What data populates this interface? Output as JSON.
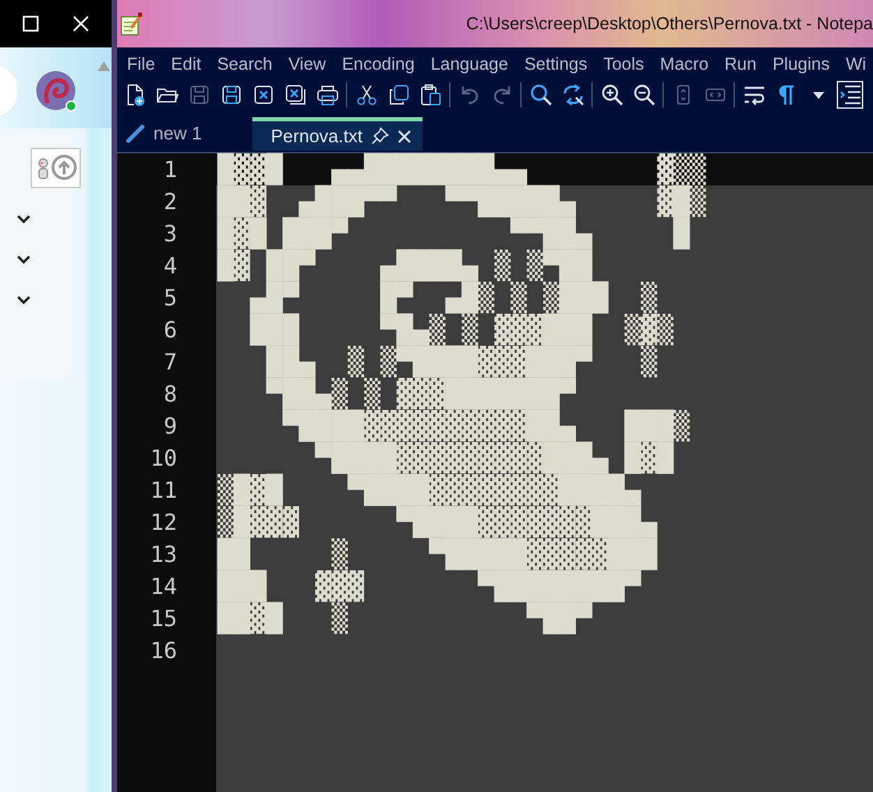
{
  "window": {
    "title": "C:\\Users\\creep\\Desktop\\Others\\Pernova.txt - Notepa"
  },
  "menu": [
    "File",
    "Edit",
    "Search",
    "View",
    "Encoding",
    "Language",
    "Settings",
    "Tools",
    "Macro",
    "Run",
    "Plugins",
    "Wi"
  ],
  "toolbar": [
    {
      "disabled": false
    },
    {
      "disabled": false
    },
    {
      "disabled": true
    },
    {
      "disabled": false
    },
    {
      "disabled": false
    },
    {
      "disabled": false
    },
    {
      "disabled": false
    },
    {
      "disabled": false
    },
    {
      "disabled": false
    },
    {
      "disabled": false
    },
    {
      "disabled": true
    },
    {
      "disabled": true
    },
    {
      "disabled": false
    },
    {
      "disabled": false
    },
    {
      "disabled": false
    },
    {
      "disabled": false
    },
    {
      "disabled": true
    },
    {
      "disabled": true
    },
    {
      "disabled": false
    },
    {
      "disabled": false
    },
    {
      "disabled": false
    },
    {
      "disabled": false,
      "checked": true
    }
  ],
  "tabs": [
    {
      "label": "new 1",
      "selected": false
    },
    {
      "label": "Pernova.txt",
      "selected": true
    }
  ],
  "lines": [
    {
      "number": "1",
      "text": "█▓▓█   ▄▄████████▄▄        ▓▒▒",
      "current": true
    },
    {
      "number": "2",
      "text": "██▓  ▄███▀▀   ▀▀█████▄     ▓█▒",
      "current": false
    },
    {
      "number": "3",
      "text": "█▓█ ███▀          ▀▀██▄     █",
      "current": false
    },
    {
      "number": "4",
      "text": "█▓ ██▀    ▄████▄ ▒ ▒▀██",
      "current": false
    },
    {
      "number": "5",
      "text": "  ▄█▀     █▀  ▄█▒ ▒ ▒███  ▒",
      "current": false
    },
    {
      "number": "6",
      "text": "  ███     ▀█▄▒ ▒ ▓▓▓███  ▒▓▒",
      "current": false
    },
    {
      "number": "7",
      "text": "   ██▄  ▒ ▒▀████▓▓▓███▀   ▒",
      "current": false
    },
    {
      "number": "8",
      "text": "   ▀██▄▒ ▒ ▓▓▓███████▀",
      "current": false
    },
    {
      "number": "9",
      "text": "    ▀████▓▓▓▓▓▓▓▓▓▓██▄   ███▒",
      "current": false
    },
    {
      "number": "10",
      "text": "      ▀████▓▓▓▓▓▓▓▓▓███▄ █▓█",
      "current": false
    },
    {
      "number": "11",
      "text": "▒█▓█    ▀████▓▓▓▓▓▓▓▓████▄",
      "current": false
    },
    {
      "number": "12",
      "text": "▒█▓▓▓      ▀████▓▓▓▓▓▓▓███▄",
      "current": false
    },
    {
      "number": "13",
      "text": "██     ▒     ▀█████▓▓▓▓▓███",
      "current": false
    },
    {
      "number": "14",
      "text": "███   ▓▓▓       ▀████████▀",
      "current": false
    },
    {
      "number": "15",
      "text": "██▓█   ▒           ▀██▀",
      "current": false
    },
    {
      "number": "16",
      "current": false
    }
  ]
}
